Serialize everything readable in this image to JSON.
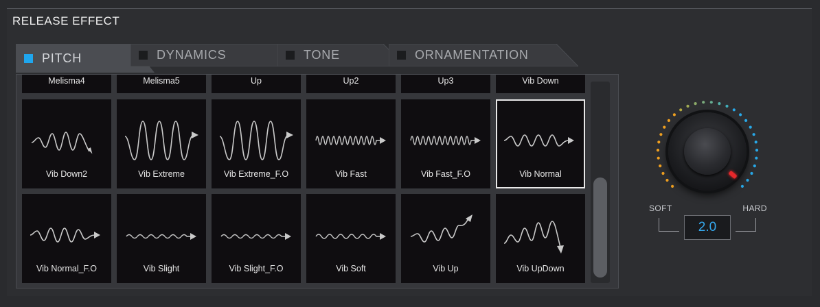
{
  "panel": {
    "title": "RELEASE EFFECT"
  },
  "tabs": [
    {
      "label": "PITCH",
      "active": true
    },
    {
      "label": "DYNAMICS",
      "active": false
    },
    {
      "label": "TONE",
      "active": false
    },
    {
      "label": "ORNAMENTATION",
      "active": false
    }
  ],
  "partial_row": [
    "Melisma4",
    "Melisma5",
    "Up",
    "Up2",
    "Up3",
    "Vib Down"
  ],
  "rows": [
    [
      {
        "name": "Vib Down2",
        "icon": "vib-down-wave-icon"
      },
      {
        "name": "Vib Extreme",
        "icon": "vib-extreme-wave-icon"
      },
      {
        "name": "Vib Extreme_F.O",
        "icon": "vib-extreme-fo-wave-icon"
      },
      {
        "name": "Vib Fast",
        "icon": "vib-fast-wave-icon"
      },
      {
        "name": "Vib Fast_F.O",
        "icon": "vib-fast-fo-wave-icon"
      },
      {
        "name": "Vib Normal",
        "icon": "vib-normal-wave-icon",
        "selected": true
      }
    ],
    [
      {
        "name": "Vib Normal_F.O",
        "icon": "vib-normal-fo-wave-icon"
      },
      {
        "name": "Vib Slight",
        "icon": "vib-slight-wave-icon"
      },
      {
        "name": "Vib Slight_F.O",
        "icon": "vib-slight-fo-wave-icon"
      },
      {
        "name": "Vib Soft",
        "icon": "vib-soft-wave-icon"
      },
      {
        "name": "Vib Up",
        "icon": "vib-up-wave-icon"
      },
      {
        "name": "Vib UpDown",
        "icon": "vib-updown-wave-icon"
      }
    ]
  ],
  "knob": {
    "label_soft": "SOFT",
    "label_hard": "HARD",
    "value": "2.0",
    "colors": {
      "warm": "#f0a020",
      "cool": "#28a8e8",
      "indicator": "#e6282b",
      "value_text": "#35a8ee"
    }
  }
}
